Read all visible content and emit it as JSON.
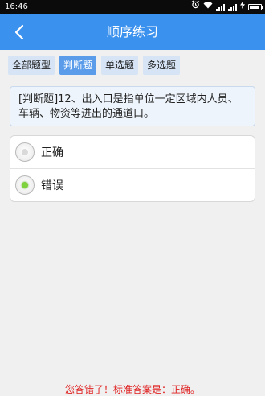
{
  "status_bar": {
    "time": "16:46",
    "icons": [
      "alarm-icon",
      "wifi-icon",
      "signal-icon",
      "signal-icon",
      "charging-icon",
      "battery-icon"
    ]
  },
  "header": {
    "title": "顺序练习",
    "back_icon": "chevron-left-icon",
    "color": "#3b91ee"
  },
  "tabs": [
    {
      "label": "全部题型",
      "active": false
    },
    {
      "label": "判断题",
      "active": true
    },
    {
      "label": "单选题",
      "active": false
    },
    {
      "label": "多选题",
      "active": false
    }
  ],
  "question": {
    "text": "[判断题]12、出入口是指单位一定区域内人员、车辆、物资等进出的通道口。"
  },
  "options": [
    {
      "label": "正确",
      "selected": false
    },
    {
      "label": "错误",
      "selected": true
    }
  ],
  "result": {
    "message": "您答错了！标准答案是：正确。",
    "color": "#e02020"
  }
}
